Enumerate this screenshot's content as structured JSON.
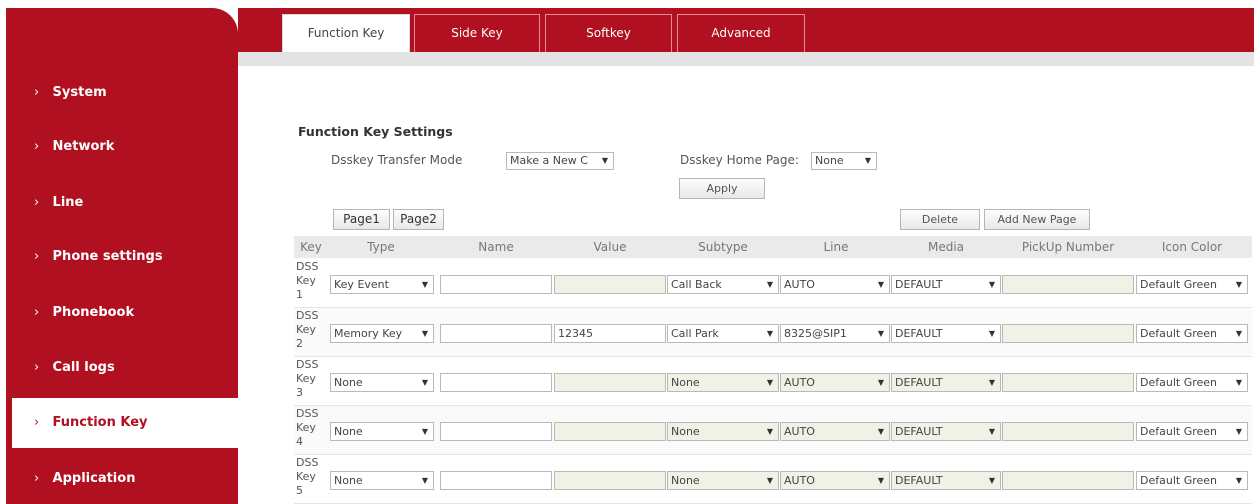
{
  "sidebar": {
    "items": [
      {
        "label": "System"
      },
      {
        "label": "Network"
      },
      {
        "label": "Line"
      },
      {
        "label": "Phone settings"
      },
      {
        "label": "Phonebook"
      },
      {
        "label": "Call logs"
      },
      {
        "label": "Function Key",
        "active": true
      },
      {
        "label": "Application"
      }
    ]
  },
  "tabs": [
    {
      "label": "Function Key",
      "active": true
    },
    {
      "label": "Side Key"
    },
    {
      "label": "Softkey"
    },
    {
      "label": "Advanced"
    }
  ],
  "section": {
    "title": "Function Key Settings",
    "transfer_mode_label": "Dsskey Transfer Mode",
    "transfer_mode_value": "Make a New C",
    "home_page_label": "Dsskey Home Page:",
    "home_page_value": "None",
    "apply_label": "Apply"
  },
  "pages": {
    "page1": "Page1",
    "page2": "Page2",
    "delete_label": "Delete",
    "add_page_label": "Add New Page"
  },
  "table": {
    "headers": [
      "Key",
      "Type",
      "Name",
      "Value",
      "Subtype",
      "Line",
      "Media",
      "PickUp Number",
      "Icon Color"
    ],
    "rows": [
      {
        "key": [
          "DSS",
          "Key",
          "1"
        ],
        "type": "Key Event",
        "name": "",
        "value": "",
        "subtype": "Call Back",
        "line": "AUTO",
        "media": "DEFAULT",
        "pickup": "",
        "color": "Default Green"
      },
      {
        "key": [
          "DSS",
          "Key",
          "2"
        ],
        "type": "Memory Key",
        "name": "",
        "value": "12345",
        "subtype": "Call Park",
        "line": "8325@SIP1",
        "media": "DEFAULT",
        "pickup": "",
        "color": "Default Green"
      },
      {
        "key": [
          "DSS",
          "Key",
          "3"
        ],
        "type": "None",
        "name": "",
        "value": "",
        "subtype": "None",
        "line": "AUTO",
        "media": "DEFAULT",
        "pickup": "",
        "color": "Default Green"
      },
      {
        "key": [
          "DSS",
          "Key",
          "4"
        ],
        "type": "None",
        "name": "",
        "value": "",
        "subtype": "None",
        "line": "AUTO",
        "media": "DEFAULT",
        "pickup": "",
        "color": "Default Green"
      },
      {
        "key": [
          "DSS",
          "Key",
          "5"
        ],
        "type": "None",
        "name": "",
        "value": "",
        "subtype": "None",
        "line": "AUTO",
        "media": "DEFAULT",
        "pickup": "",
        "color": "Default Green"
      }
    ]
  },
  "colors": {
    "brand": "#b0101f",
    "header_bg": "#eaeaea"
  }
}
